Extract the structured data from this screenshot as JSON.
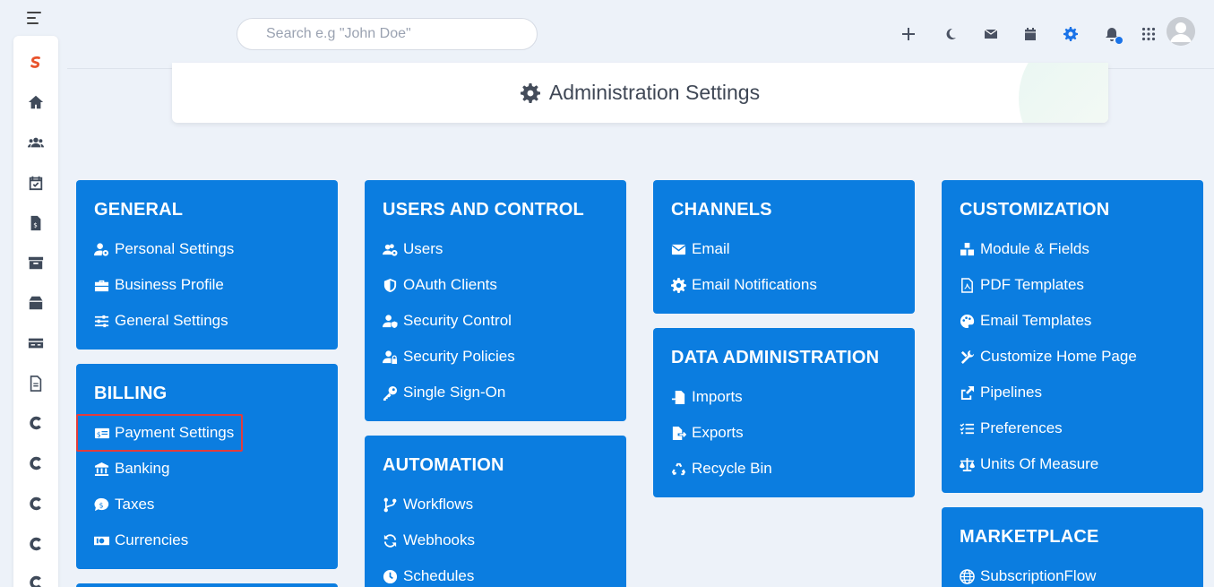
{
  "search": {
    "placeholder": "Search e.g \"John Doe\""
  },
  "header": {
    "title": "Administration Settings"
  },
  "sidebar": {
    "icons": [
      "logo-icon",
      "home-icon",
      "users-icon",
      "calendar-check-icon",
      "invoice-icon",
      "archive-icon",
      "box-icon",
      "card-icon",
      "document-icon",
      "c-icon",
      "c-icon",
      "c-icon",
      "c-icon",
      "c-icon"
    ]
  },
  "topbar": {
    "icons": [
      "plus-icon",
      "moon-icon",
      "mail-icon",
      "calendar-icon",
      "gear-icon",
      "bell-icon",
      "apps-grid-icon"
    ]
  },
  "sections": {
    "general": {
      "title": "GENERAL",
      "items": [
        "Personal Settings",
        "Business Profile",
        "General Settings"
      ]
    },
    "billing": {
      "title": "BILLING",
      "items": [
        "Payment Settings",
        "Banking",
        "Taxes",
        "Currencies"
      ]
    },
    "users": {
      "title": "USERS AND CONTROL",
      "items": [
        "Users",
        "OAuth Clients",
        "Security Control",
        "Security Policies",
        "Single Sign-On"
      ]
    },
    "automation": {
      "title": "AUTOMATION",
      "items": [
        "Workflows",
        "Webhooks",
        "Schedules"
      ]
    },
    "channels": {
      "title": "CHANNELS",
      "items": [
        "Email",
        "Email Notifications"
      ]
    },
    "data": {
      "title": "DATA ADMINISTRATION",
      "items": [
        "Imports",
        "Exports",
        "Recycle Bin"
      ]
    },
    "customization": {
      "title": "CUSTOMIZATION",
      "items": [
        "Module & Fields",
        "PDF Templates",
        "Email Templates",
        "Customize Home Page",
        "Pipelines",
        "Preferences",
        "Units Of Measure"
      ]
    },
    "marketplace": {
      "title": "MARKETPLACE",
      "items": [
        "SubscriptionFlow"
      ]
    }
  },
  "colors": {
    "card": "#0b7de0",
    "highlight": "#e23c3c",
    "accent": "#1a73e8"
  }
}
